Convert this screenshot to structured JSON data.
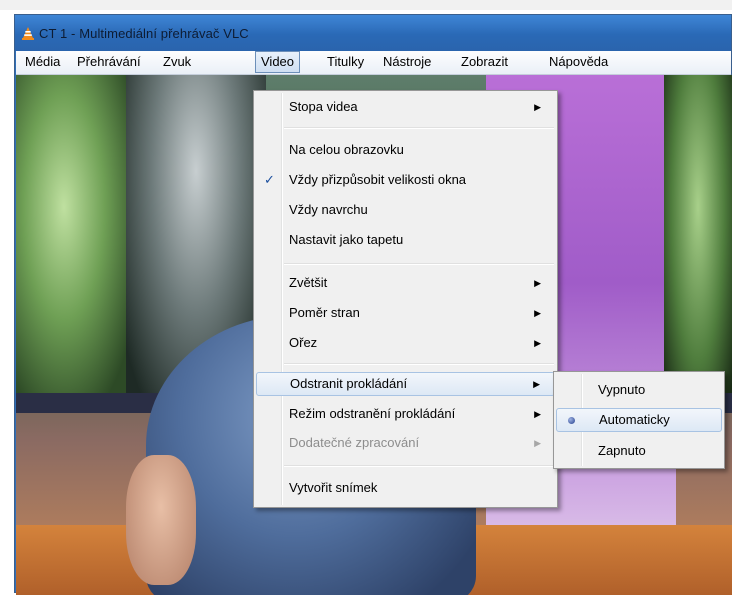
{
  "window": {
    "title": "CT 1 - Multimediální přehrávač VLC",
    "app_icon": "vlc-cone-icon"
  },
  "menubar": {
    "items": [
      {
        "label": "Média"
      },
      {
        "label": "Přehrávání"
      },
      {
        "label": "Zvuk"
      },
      {
        "label": "Video",
        "active": true
      },
      {
        "label": "Titulky"
      },
      {
        "label": "Nástroje"
      },
      {
        "label": "Zobrazit"
      },
      {
        "label": "Nápověda"
      }
    ]
  },
  "video_menu": {
    "items": [
      {
        "label": "Stopa videa",
        "submenu": true
      },
      {
        "label": "Na celou obrazovku"
      },
      {
        "label": "Vždy přizpůsobit velikosti okna",
        "checked": true,
        "check_mark": "✓"
      },
      {
        "label": "Vždy navrchu"
      },
      {
        "label": "Nastavit jako tapetu"
      },
      {
        "label": "Zvětšit",
        "submenu": true
      },
      {
        "label": "Poměr stran",
        "submenu": true
      },
      {
        "label": "Ořez",
        "submenu": true
      },
      {
        "label": "Odstranit prokládání",
        "submenu": true,
        "highlighted": true
      },
      {
        "label": "Režim odstranění prokládání",
        "submenu": true
      },
      {
        "label": "Dodatečné zpracování",
        "submenu": true,
        "disabled": true
      },
      {
        "label": "Vytvořit snímek"
      }
    ],
    "arrow_glyph": "▶"
  },
  "deinterlace_submenu": {
    "items": [
      {
        "label": "Vypnuto"
      },
      {
        "label": "Automaticky",
        "selected": true,
        "highlighted": true
      },
      {
        "label": "Zapnuto"
      }
    ]
  },
  "colors": {
    "titlebar": "#2a69b6",
    "menu_bg": "#f0f0f0",
    "highlight_border": "#a8c3e3",
    "check": "#1b4f9e"
  }
}
